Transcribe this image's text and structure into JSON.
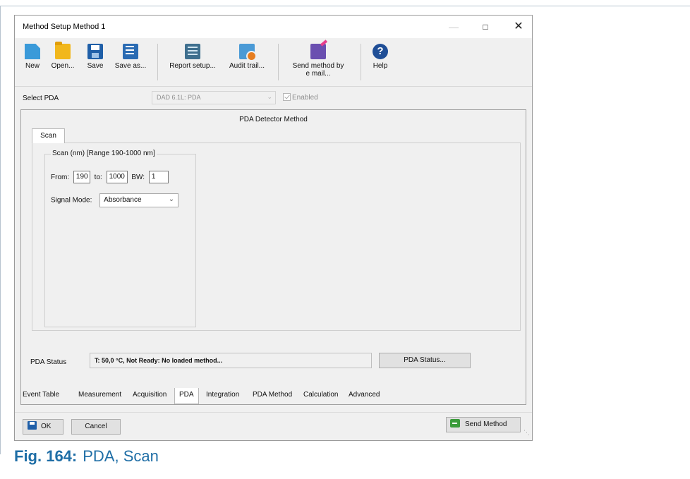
{
  "window": {
    "title": "Method Setup Method 1",
    "controls": {
      "minimize": "—",
      "maximize": "□",
      "close": "✕"
    }
  },
  "toolbar": {
    "new": "New",
    "open": "Open...",
    "save": "Save",
    "save_as": "Save as...",
    "report_setup": "Report setup...",
    "audit_trail": "Audit trail...",
    "send_method_line1": "Send method by",
    "send_method_line2": "e mail...",
    "help": "Help"
  },
  "select_pda": {
    "label": "Select PDA",
    "value": "DAD 6.1L: PDA",
    "enabled_label": "Enabled"
  },
  "panel": {
    "title": "PDA Detector Method",
    "tab": "Scan",
    "group_title": "Scan (nm) [Range 190-1000 nm]",
    "from_label": "From:",
    "from_value": "190",
    "to_label": "to:",
    "to_value": "1000",
    "bw_label": "BW:",
    "bw_value": "1",
    "signal_mode_label": "Signal Mode:",
    "signal_mode_value": "Absorbance"
  },
  "status": {
    "label": "PDA Status",
    "text": "T: 50,0 °C, Not Ready: No loaded method...",
    "button": "PDA Status..."
  },
  "bottom_tabs": [
    "Event Table",
    "Measurement",
    "Acquisition",
    "PDA",
    "Integration",
    "PDA Method",
    "Calculation",
    "Advanced"
  ],
  "footer": {
    "ok": "OK",
    "cancel": "Cancel",
    "send_method": "Send Method"
  },
  "caption": {
    "number": "Fig. 164:",
    "text": "PDA, Scan"
  },
  "colors": {
    "accent": "#1f6ea6",
    "window_bg": "#f0f0f0"
  }
}
